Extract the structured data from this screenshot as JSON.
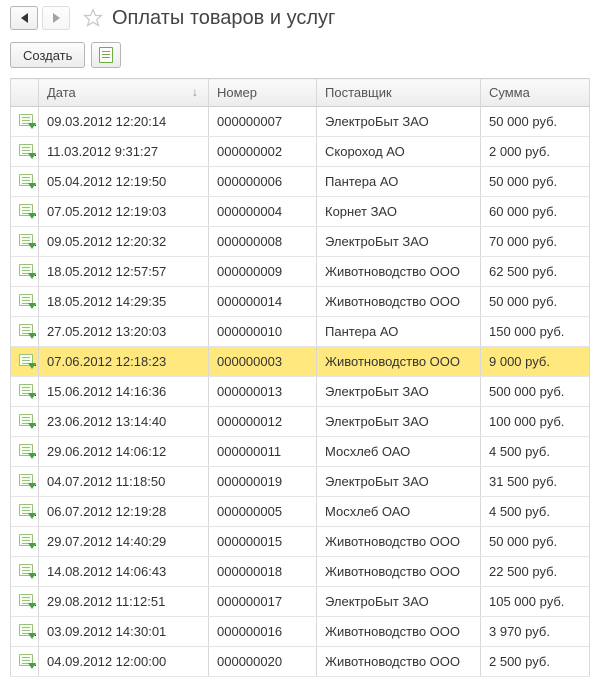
{
  "header": {
    "title": "Оплаты товаров и услуг"
  },
  "toolbar": {
    "create_label": "Создать"
  },
  "columns": {
    "date": "Дата",
    "number": "Номер",
    "supplier": "Поставщик",
    "sum": "Сумма",
    "sort_indicator": "↓"
  },
  "rows": [
    {
      "date": "09.03.2012 12:20:14",
      "number": "000000007",
      "supplier": "ЭлектроБыт ЗАО",
      "sum": "50 000 руб."
    },
    {
      "date": "11.03.2012 9:31:27",
      "number": "000000002",
      "supplier": "Скороход АО",
      "sum": "2 000 руб."
    },
    {
      "date": "05.04.2012 12:19:50",
      "number": "000000006",
      "supplier": "Пантера АО",
      "sum": "50 000 руб."
    },
    {
      "date": "07.05.2012 12:19:03",
      "number": "000000004",
      "supplier": "Корнет ЗАО",
      "sum": "60 000 руб."
    },
    {
      "date": "09.05.2012 12:20:32",
      "number": "000000008",
      "supplier": "ЭлектроБыт ЗАО",
      "sum": "70 000 руб."
    },
    {
      "date": "18.05.2012 12:57:57",
      "number": "000000009",
      "supplier": "Животноводство ООО",
      "sum": "62 500 руб."
    },
    {
      "date": "18.05.2012 14:29:35",
      "number": "000000014",
      "supplier": "Животноводство ООО",
      "sum": "50 000 руб."
    },
    {
      "date": "27.05.2012 13:20:03",
      "number": "000000010",
      "supplier": "Пантера АО",
      "sum": "150 000 руб."
    },
    {
      "date": "07.06.2012 12:18:23",
      "number": "000000003",
      "supplier": "Животноводство ООО",
      "sum": "9 000 руб.",
      "selected": true
    },
    {
      "date": "15.06.2012 14:16:36",
      "number": "000000013",
      "supplier": "ЭлектроБыт ЗАО",
      "sum": "500 000 руб."
    },
    {
      "date": "23.06.2012 13:14:40",
      "number": "000000012",
      "supplier": "ЭлектроБыт ЗАО",
      "sum": "100 000 руб."
    },
    {
      "date": "29.06.2012 14:06:12",
      "number": "000000011",
      "supplier": "Мосхлеб ОАО",
      "sum": "4 500 руб."
    },
    {
      "date": "04.07.2012 11:18:50",
      "number": "000000019",
      "supplier": "ЭлектроБыт ЗАО",
      "sum": "31 500 руб."
    },
    {
      "date": "06.07.2012 12:19:28",
      "number": "000000005",
      "supplier": "Мосхлеб ОАО",
      "sum": "4 500 руб."
    },
    {
      "date": "29.07.2012 14:40:29",
      "number": "000000015",
      "supplier": "Животноводство ООО",
      "sum": "50 000 руб."
    },
    {
      "date": "14.08.2012 14:06:43",
      "number": "000000018",
      "supplier": "Животноводство ООО",
      "sum": "22 500 руб."
    },
    {
      "date": "29.08.2012 11:12:51",
      "number": "000000017",
      "supplier": "ЭлектроБыт ЗАО",
      "sum": "105 000 руб."
    },
    {
      "date": "03.09.2012 14:30:01",
      "number": "000000016",
      "supplier": "Животноводство ООО",
      "sum": "3 970 руб."
    },
    {
      "date": "04.09.2012 12:00:00",
      "number": "000000020",
      "supplier": "Животноводство ООО",
      "sum": "2 500 руб."
    }
  ]
}
